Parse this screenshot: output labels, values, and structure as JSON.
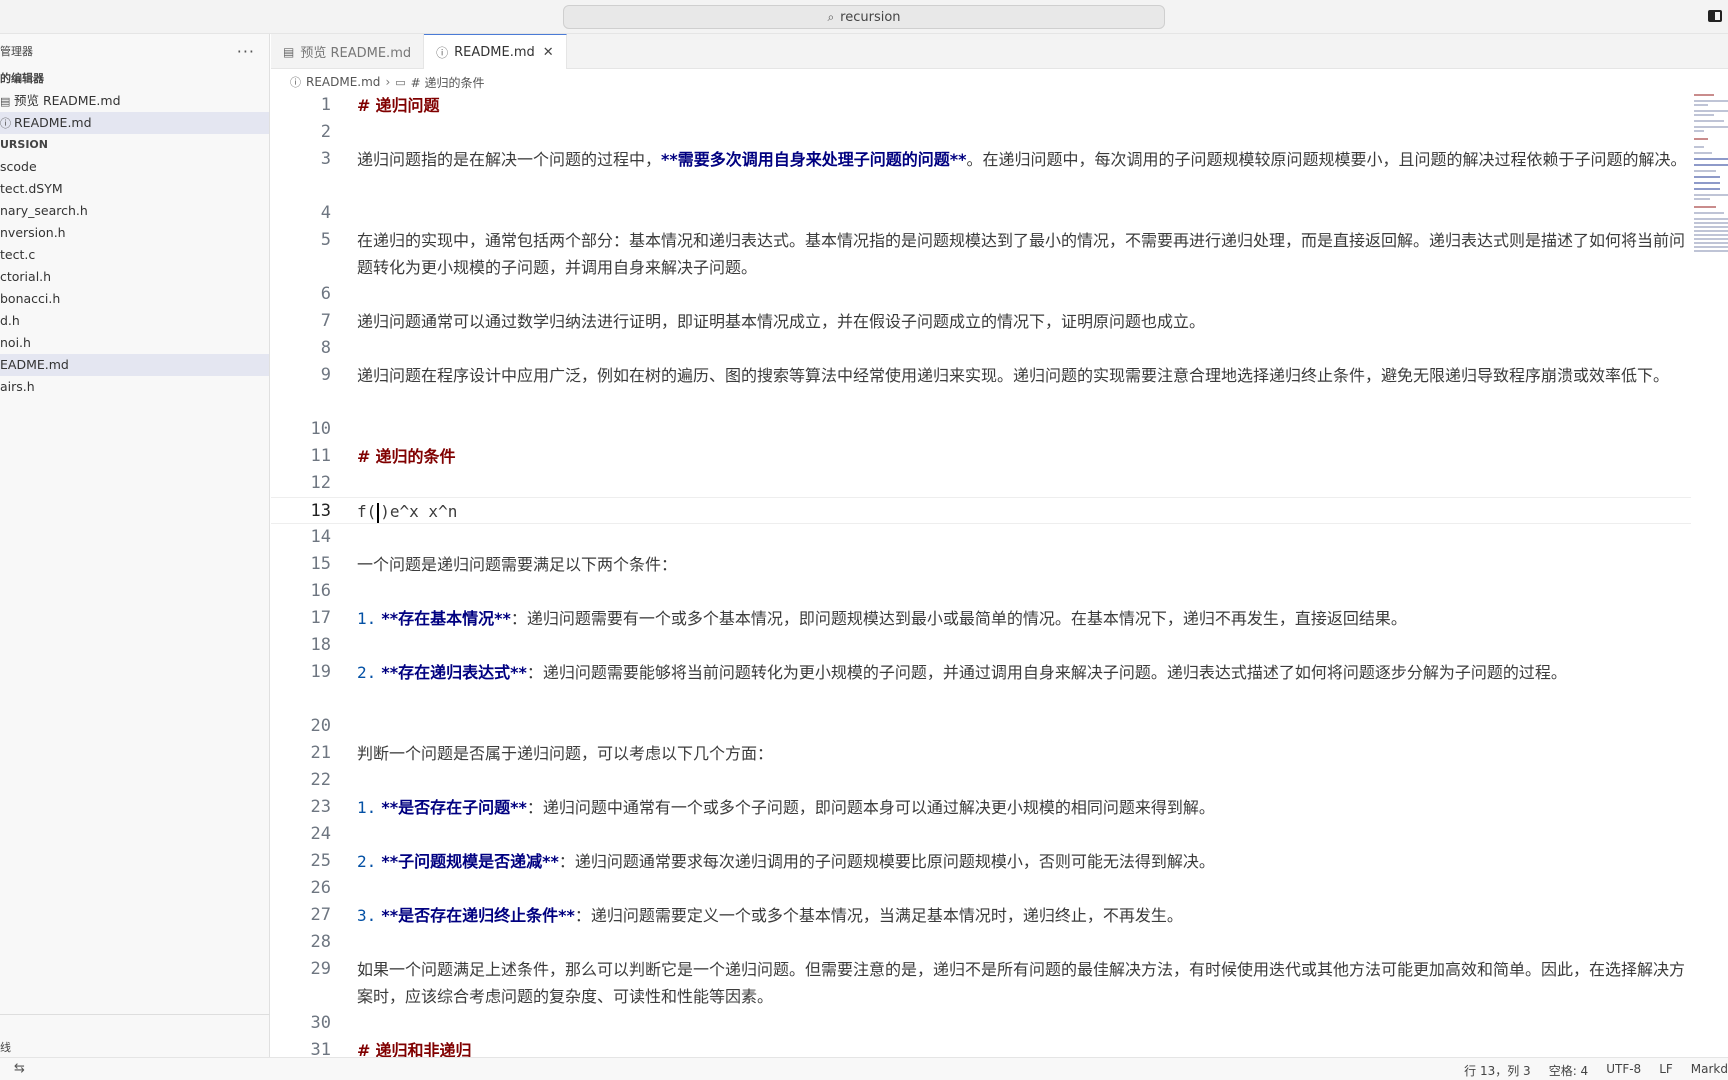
{
  "titlebar": {
    "search_text": "recursion"
  },
  "sidebar": {
    "header": "管理器",
    "more": "···",
    "open_editors_label": "的编辑器",
    "open_editors": [
      {
        "label": "预览 README.md",
        "icon": "preview-icon"
      },
      {
        "label": "README.md",
        "icon": "info-icon",
        "selected": true
      }
    ],
    "folder_label": "URSION",
    "files": [
      {
        "label": "scode"
      },
      {
        "label": "tect.dSYM"
      },
      {
        "label": "nary_search.h"
      },
      {
        "label": "nversion.h"
      },
      {
        "label": "tect.c"
      },
      {
        "label": "ctorial.h"
      },
      {
        "label": "bonacci.h"
      },
      {
        "label": "d.h"
      },
      {
        "label": "noi.h"
      },
      {
        "label": "EADME.md",
        "selected": true
      },
      {
        "label": "airs.h"
      }
    ],
    "bottom_label": "线"
  },
  "tabs": [
    {
      "label": "预览 README.md",
      "icon": "preview-icon",
      "active": false
    },
    {
      "label": "README.md",
      "icon": "info-icon",
      "active": true
    }
  ],
  "breadcrumb": {
    "file": "README.md",
    "symbol": "# 递归的条件"
  },
  "editor": {
    "lines": {
      "l1": {
        "n": "1",
        "mark": "#",
        "text": "递归问题"
      },
      "l2": {
        "n": "2"
      },
      "l3": {
        "n": "3",
        "a": "递归问题指的是在解决一个问题的过程中，",
        "b": "**需要多次调用自身来处理子问题的问题**",
        "c": "。在递归问题中，每次调用的子问题规模较原问题规模要小，且问题的解决过程依赖于子问题的解决。"
      },
      "l4": {
        "n": "4"
      },
      "l5": {
        "n": "5",
        "text": "在递归的实现中，通常包括两个部分：基本情况和递归表达式。基本情况指的是问题规模达到了最小的情况，不需要再进行递归处理，而是直接返回解。递归表达式则是描述了如何将当前问题转化为更小规模的子问题，并调用自身来解决子问题。"
      },
      "l6": {
        "n": "6"
      },
      "l7": {
        "n": "7",
        "text": "递归问题通常可以通过数学归纳法进行证明，即证明基本情况成立，并在假设子问题成立的情况下，证明原问题也成立。"
      },
      "l8": {
        "n": "8"
      },
      "l9": {
        "n": "9",
        "text": "递归问题在程序设计中应用广泛，例如在树的遍历、图的搜索等算法中经常使用递归来实现。递归问题的实现需要注意合理地选择递归终止条件，避免无限递归导致程序崩溃或效率低下。"
      },
      "l10": {
        "n": "10"
      },
      "l11": {
        "n": "11",
        "mark": "#",
        "text": "递归的条件"
      },
      "l12": {
        "n": "12"
      },
      "l13": {
        "n": "13",
        "pre": "f(",
        "post": ")e^x x^n"
      },
      "l14": {
        "n": "14"
      },
      "l15": {
        "n": "15",
        "text": "一个问题是递归问题需要满足以下两个条件："
      },
      "l16": {
        "n": "16"
      },
      "l17": {
        "n": "17",
        "num": "1.",
        "b": "**存在基本情况**",
        "c": "：递归问题需要有一个或多个基本情况，即问题规模达到最小或最简单的情况。在基本情况下，递归不再发生，直接返回结果。"
      },
      "l18": {
        "n": "18"
      },
      "l19": {
        "n": "19",
        "num": "2.",
        "b": "**存在递归表达式**",
        "c": "：递归问题需要能够将当前问题转化为更小规模的子问题，并通过调用自身来解决子问题。递归表达式描述了如何将问题逐步分解为子问题的过程。"
      },
      "l20": {
        "n": "20"
      },
      "l21": {
        "n": "21",
        "text": "判断一个问题是否属于递归问题，可以考虑以下几个方面："
      },
      "l22": {
        "n": "22"
      },
      "l23": {
        "n": "23",
        "num": "1.",
        "b": "**是否存在子问题**",
        "c": "：递归问题中通常有一个或多个子问题，即问题本身可以通过解决更小规模的相同问题来得到解。"
      },
      "l24": {
        "n": "24"
      },
      "l25": {
        "n": "25",
        "num": "2.",
        "b": "**子问题规模是否递减**",
        "c": "：递归问题通常要求每次递归调用的子问题规模要比原问题规模小，否则可能无法得到解决。"
      },
      "l26": {
        "n": "26"
      },
      "l27": {
        "n": "27",
        "num": "3.",
        "b": "**是否存在递归终止条件**",
        "c": "：递归问题需要定义一个或多个基本情况，当满足基本情况时，递归终止，不再发生。"
      },
      "l28": {
        "n": "28"
      },
      "l29": {
        "n": "29",
        "text": "如果一个问题满足上述条件，那么可以判断它是一个递归问题。但需要注意的是，递归不是所有问题的最佳解决方法，有时候使用迭代或其他方法可能更加高效和简单。因此，在选择解决方案时，应该综合考虑问题的复杂度、可读性和性能等因素。"
      },
      "l30": {
        "n": "30"
      },
      "l31": {
        "n": "31",
        "mark": "#",
        "text": "递归和非递归"
      }
    }
  },
  "statusbar": {
    "left_icon": "remote-icon",
    "position": "行 13，列 3",
    "spaces": "空格: 4",
    "encoding": "UTF-8",
    "eol": "LF",
    "language": "Markd"
  }
}
